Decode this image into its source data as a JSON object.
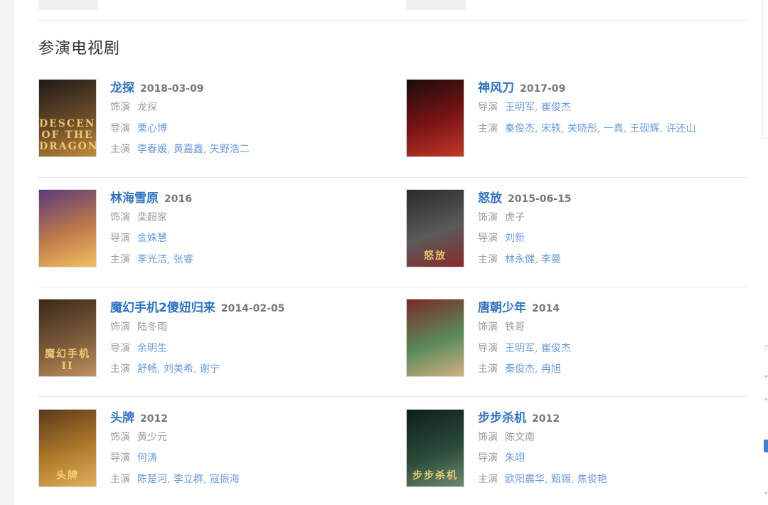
{
  "section": {
    "title": "参演电视剧"
  },
  "labels": {
    "role": "饰演",
    "director": "导演",
    "cast": "主演"
  },
  "comma": ", ",
  "colors": {
    "link": "#2f73c4",
    "person_link": "#6b9bd8",
    "muted": "#999999",
    "divider": "#e6e6e6"
  },
  "items": [
    {
      "title": "龙探",
      "date": "2018-03-09",
      "role": "龙探",
      "directors": [
        "栗心博"
      ],
      "cast": [
        "李春媛",
        "黄嘉鑫",
        "矢野浩二"
      ],
      "poster_text": "DESCENDANTS OF THE DRAGON",
      "poster_colors": [
        "#1e1b18",
        "#6b4b2a",
        "#c08a3c"
      ]
    },
    {
      "title": "神风刀",
      "date": "2017-09",
      "role": "",
      "directors": [
        "王明军",
        "崔俊杰"
      ],
      "cast": [
        "秦俊杰",
        "宋轶",
        "关晓彤",
        "一真",
        "王砚辉",
        "许还山"
      ],
      "poster_text": "",
      "poster_colors": [
        "#1a0c0c",
        "#7d1414",
        "#c03a2a"
      ]
    },
    {
      "title": "林海雪原",
      "date": "2016",
      "role": "栾超家",
      "directors": [
        "金姝慧"
      ],
      "cast": [
        "李光洁",
        "张睿"
      ],
      "poster_text": "",
      "poster_colors": [
        "#5b3a7a",
        "#c07a4a",
        "#f0c060"
      ]
    },
    {
      "title": "怒放",
      "date": "2015-06-15",
      "role": "虎子",
      "directors": [
        "刘新"
      ],
      "cast": [
        "林永健",
        "李曼"
      ],
      "poster_text": "怒放",
      "poster_colors": [
        "#2a2a2a",
        "#5a5a5a",
        "#8a2a2a"
      ]
    },
    {
      "title": "魔幻手机2傻妞归来",
      "date": "2014-02-05",
      "role": "陆冬雨",
      "directors": [
        "余明生"
      ],
      "cast": [
        "舒畅",
        "刘美希",
        "谢宁"
      ],
      "poster_text": "魔幻手机II",
      "poster_colors": [
        "#3a2a1a",
        "#7a5a3a",
        "#c09060"
      ]
    },
    {
      "title": "唐朝少年",
      "date": "2014",
      "role": "铁哥",
      "directors": [
        "王明军",
        "崔俊杰"
      ],
      "cast": [
        "秦俊杰",
        "冉旭"
      ],
      "poster_text": "",
      "poster_colors": [
        "#7a2a2a",
        "#5a8a5a",
        "#d0b080"
      ]
    },
    {
      "title": "头牌",
      "date": "2012",
      "role": "黄少元",
      "directors": [
        "何涛"
      ],
      "cast": [
        "陈楚河",
        "李立群",
        "寇振海"
      ],
      "poster_text": "头牌",
      "poster_colors": [
        "#5a3a1a",
        "#b07a2a",
        "#e0b060"
      ]
    },
    {
      "title": "步步杀机",
      "date": "2012",
      "role": "陈文南",
      "directors": [
        "朱翊"
      ],
      "cast": [
        "欧阳震华",
        "甄锡",
        "焦俊艳"
      ],
      "poster_text": "步步杀机",
      "poster_colors": [
        "#0e1e1a",
        "#2a4a3a",
        "#6a8a6a"
      ]
    }
  ]
}
